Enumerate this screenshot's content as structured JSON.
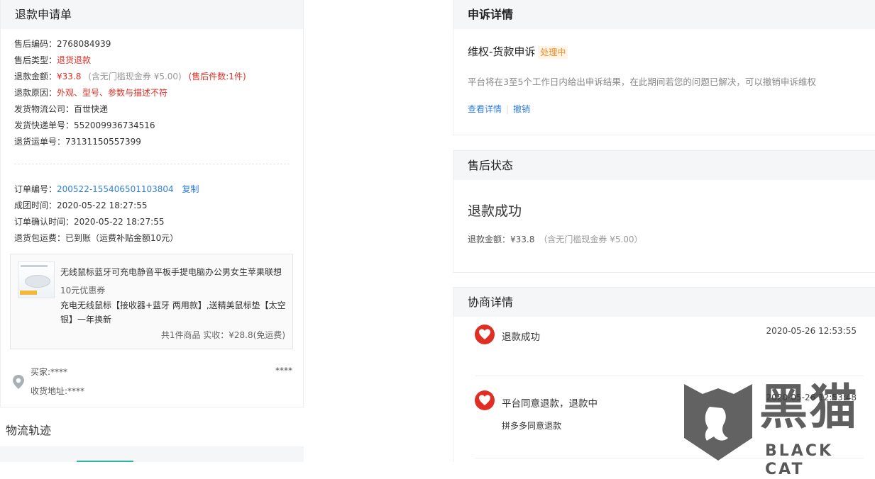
{
  "refund_panel": {
    "title": "退款申请单",
    "after_sale_code_label": "售后编码：",
    "after_sale_code": "2768084939",
    "after_sale_type_label": "售后类型：",
    "after_sale_type": "退货退款",
    "refund_amount_label": "退款金额：",
    "refund_amount": "¥33.8",
    "refund_amount_coupon": "(含无门槛现金券 ¥5.00)",
    "refund_amount_count": "(售后件数:1件)",
    "refund_reason_label": "退款原因：",
    "refund_reason": "外观、型号、参数与描述不符",
    "ship_company_label": "发货物流公司：",
    "ship_company": "百世快递",
    "ship_tracking_label": "发货快递单号：",
    "ship_tracking": "552009936734516",
    "return_tracking_label": "退货运单号：",
    "return_tracking": "73131150557399",
    "order_no_label": "订单编号：",
    "order_no": "200522-155406501103804",
    "copy_label": "复制",
    "group_time_label": "成团时间：",
    "group_time": "2020-05-22 18:27:55",
    "confirm_time_label": "订单确认时间：",
    "confirm_time": "2020-05-22 18:27:55",
    "return_shipping_label": "退货包运费：",
    "return_shipping": "已到账（运费补贴金额10元）",
    "product": {
      "name": "无线鼠标蓝牙可充电静音平板手提电脑办公男女生苹果联想",
      "coupon": "10元优惠券",
      "spec": "充电无线鼠标【接收器+蓝牙 两用款】,送精美鼠标垫【太空银】一年换新",
      "summary": "共1件商品   实收：¥28.8(免运费)"
    },
    "buyer_label": "买家:****",
    "buyer_phone": "****",
    "address_label": "收货地址:****"
  },
  "logistics": {
    "title": "物流轨迹"
  },
  "appeal_panel": {
    "title": "申诉详情",
    "subject": "维权-货款申诉",
    "status_tag": "处理中",
    "desc": "平台将在3至5个工作日内给出申诉结果，在此期间若您的问题已解决，可以撤销申诉维权",
    "view_link": "查看详情",
    "cancel_link": "撤销"
  },
  "status_panel": {
    "title": "售后状态",
    "status": "退款成功",
    "amount_label": "退款金额：",
    "amount": "¥33.8",
    "coupon": "（含无门槛现金券 ¥5.00）"
  },
  "negotiation_panel": {
    "title": "协商详情",
    "items": [
      {
        "text": "退款成功",
        "time": "2020-05-26 12:53:55",
        "sub": ""
      },
      {
        "text": "平台同意退款，退款中",
        "time": "2020-05-26 12:53:48",
        "sub": "拼多多同意退款"
      }
    ]
  },
  "watermark": {
    "cn": "黑猫",
    "en": "BLACK CAT"
  },
  "colors": {
    "accent_red": "#e02e24",
    "link_blue": "#2f7ed8",
    "tag_orange": "#f08a24",
    "header_bg": "#f4f6f8"
  }
}
